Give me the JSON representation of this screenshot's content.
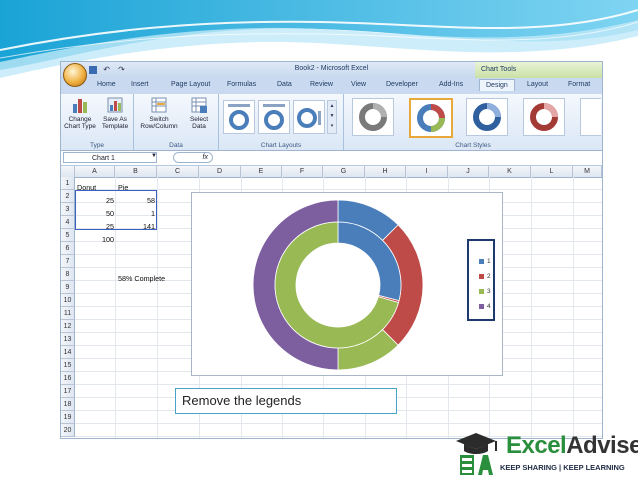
{
  "window": {
    "title": "Book2 - Microsoft Excel",
    "context_tab_group": "Chart Tools"
  },
  "qat": {
    "undo": "↶",
    "redo": "↷"
  },
  "tabs": [
    {
      "label": "Home"
    },
    {
      "label": "Insert"
    },
    {
      "label": "Page Layout"
    },
    {
      "label": "Formulas"
    },
    {
      "label": "Data"
    },
    {
      "label": "Review"
    },
    {
      "label": "View"
    },
    {
      "label": "Developer"
    },
    {
      "label": "Add-Ins"
    },
    {
      "label": "Design",
      "active": true
    },
    {
      "label": "Layout"
    },
    {
      "label": "Format"
    }
  ],
  "ribbon": {
    "type_group": {
      "label": "Type",
      "change_chart_type": "Change Chart Type",
      "save_as_template": "Save As Template"
    },
    "data_group": {
      "label": "Data",
      "switch_row_column": "Switch Row/Column",
      "select_data": "Select Data"
    },
    "layouts_group": {
      "label": "Chart Layouts"
    },
    "styles_group": {
      "label": "Chart Styles",
      "selected_index": 1
    }
  },
  "formula_bar": {
    "name_box": "Chart 1",
    "fx": "fx"
  },
  "columns": [
    "A",
    "B",
    "C",
    "D",
    "E",
    "F",
    "G",
    "H",
    "I",
    "J",
    "K",
    "L",
    "M"
  ],
  "rows": [
    "1",
    "2",
    "3",
    "4",
    "5",
    "6",
    "7",
    "8",
    "9",
    "10",
    "11",
    "12",
    "13",
    "14",
    "15",
    "16",
    "17",
    "18",
    "19",
    "20"
  ],
  "cells": {
    "a1": "Donut",
    "b1": "Pie",
    "a2": "25",
    "b2": "58",
    "a3": "50",
    "b3": "1",
    "a4": "25",
    "b4": "141",
    "a5": "100",
    "b8": "58% Complete"
  },
  "chart_data": {
    "type": "pie",
    "subtype": "doughnut",
    "series": [
      {
        "values": [
          25,
          50,
          25,
          100
        ]
      },
      {
        "values": [
          58,
          1,
          141
        ]
      }
    ],
    "categories": [
      "1",
      "2",
      "3",
      "4"
    ],
    "colors": [
      "#4a7ebb",
      "#be4b48",
      "#98b954",
      "#7d5fa0"
    ],
    "legend": {
      "position": "right",
      "entries": [
        "1",
        "2",
        "3",
        "4"
      ]
    }
  },
  "caption": "Remove the legends",
  "brand": {
    "name_part1": "Excel",
    "name_part2": "Advise",
    "tagline": "KEEP SHARING | KEEP LEARNING"
  }
}
